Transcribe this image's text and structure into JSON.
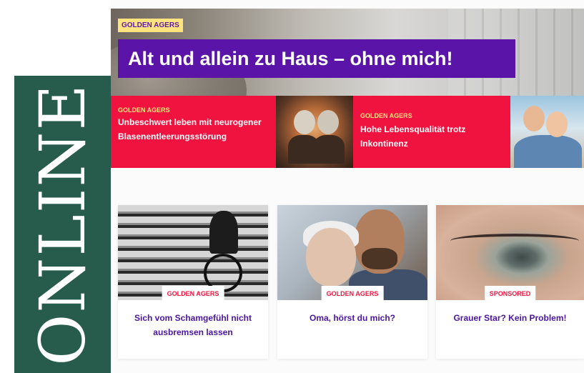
{
  "side_banner": {
    "label": "ONLINE",
    "color": "#275b4b"
  },
  "hero": {
    "tag": "GOLDEN AGERS",
    "title": "Alt und allein zu Haus – ohne mich!"
  },
  "teasers": [
    {
      "tag": "GOLDEN AGERS",
      "text": "Unbeschwert leben mit neurogener Blasenentleerungsstörung"
    },
    {
      "tag": "GOLDEN AGERS",
      "text": "Hohe Lebensqualität trotz Inkontinenz"
    }
  ],
  "cards": [
    {
      "badge": "GOLDEN AGERS",
      "title": "Sich vom Schamgefühl nicht ausbremsen lassen"
    },
    {
      "badge": "GOLDEN AGERS",
      "title": "Oma, hörst du mich?"
    },
    {
      "badge": "SPONSORED",
      "title": "Grauer Star? Kein Problem!"
    }
  ],
  "colors": {
    "brand_purple": "#5a14a8",
    "accent_red": "#f0133f",
    "tag_yellow": "#ffe37f",
    "title_purple": "#4a16a0"
  }
}
